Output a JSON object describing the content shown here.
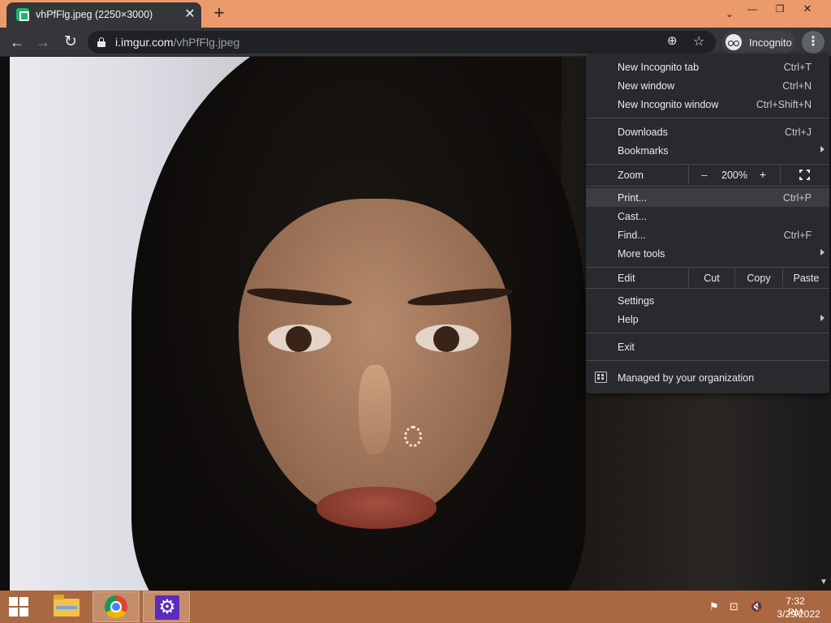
{
  "browser": {
    "tab": {
      "title": "vhPfFlg.jpeg (2250×3000)",
      "close_glyph": "✕"
    },
    "new_tab_glyph": "+",
    "window_controls": {
      "tab_search_glyph": "⌄",
      "minimize_glyph": "—",
      "maximize_glyph": "❐",
      "close_glyph": "✕"
    },
    "nav": {
      "back_glyph": "←",
      "forward_glyph": "→",
      "reload_glyph": "↻"
    },
    "url": {
      "domain": "i.imgur.com",
      "path": "/vhPfFlg.jpeg"
    },
    "zoom_glyph": "⊕",
    "star_glyph": "☆",
    "profile": {
      "label": "Incognito"
    },
    "menu_glyph": "⋮"
  },
  "menu": {
    "new_incognito_tab": {
      "label": "New Incognito tab",
      "shortcut": "Ctrl+T"
    },
    "new_window": {
      "label": "New window",
      "shortcut": "Ctrl+N"
    },
    "new_incognito_window": {
      "label": "New Incognito window",
      "shortcut": "Ctrl+Shift+N"
    },
    "downloads": {
      "label": "Downloads",
      "shortcut": "Ctrl+J"
    },
    "bookmarks": {
      "label": "Bookmarks"
    },
    "zoom": {
      "label": "Zoom",
      "minus": "–",
      "level": "200%",
      "plus": "+"
    },
    "print": {
      "label": "Print...",
      "shortcut": "Ctrl+P"
    },
    "cast": {
      "label": "Cast..."
    },
    "find": {
      "label": "Find...",
      "shortcut": "Ctrl+F"
    },
    "more_tools": {
      "label": "More tools"
    },
    "edit": {
      "label": "Edit",
      "cut": "Cut",
      "copy": "Copy",
      "paste": "Paste"
    },
    "settings": {
      "label": "Settings"
    },
    "help": {
      "label": "Help"
    },
    "exit": {
      "label": "Exit"
    },
    "managed": {
      "label": "Managed by your organization"
    }
  },
  "taskbar": {
    "settings_glyph": "⚙",
    "tray": {
      "flag_glyph": "⚑",
      "network_glyph": "⊡",
      "volume_glyph": "🔇"
    },
    "clock": {
      "time": "7:32 PM",
      "date": "3/29/2022"
    }
  },
  "colors": {
    "titlebar": "#eb9a6c",
    "taskbar": "#a96841",
    "menu_bg": "#292a2d",
    "toolbar": "#35363a"
  }
}
